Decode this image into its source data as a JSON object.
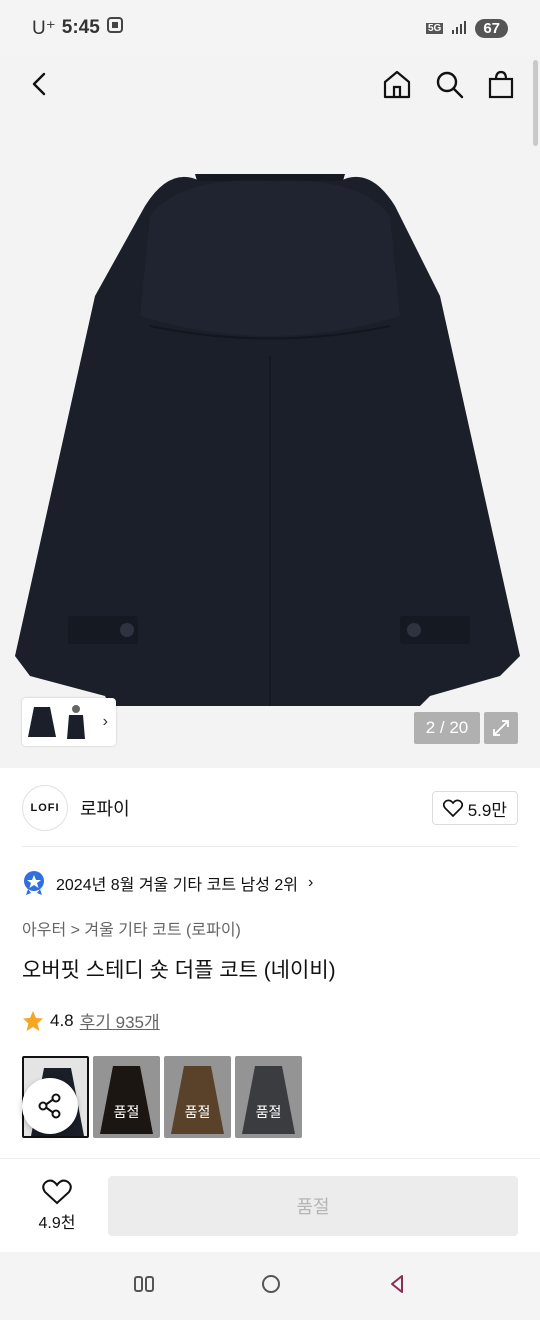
{
  "status": {
    "carrier": "U⁺",
    "time": "5:45",
    "network": "5G",
    "battery": "67"
  },
  "gallery": {
    "counter": "2 / 20"
  },
  "brand": {
    "logo_text": "LOFI",
    "name": "로파이",
    "likes": "5.9만"
  },
  "rank": {
    "text": "2024년 8월 겨울 기타 코트 남성 2위"
  },
  "breadcrumb": {
    "text": "아우터 > 겨울 기타 코트 (로파이)"
  },
  "product": {
    "title": "오버핏 스테디 숏 더플 코트 (네이비)",
    "rating": "4.8",
    "reviews": "후기 935개"
  },
  "swatches": [
    {
      "color": "#1a1e27",
      "label": ""
    },
    {
      "color": "#2b221c",
      "label": "품절"
    },
    {
      "color": "#8a6440",
      "label": "품절"
    },
    {
      "color": "#5a5d61",
      "label": "품절"
    }
  ],
  "bottom": {
    "wish_count": "4.9천",
    "buy_label": "품절"
  },
  "colors": {
    "accent_star": "#f5a623",
    "rank_badge": "#2f6fdf"
  }
}
